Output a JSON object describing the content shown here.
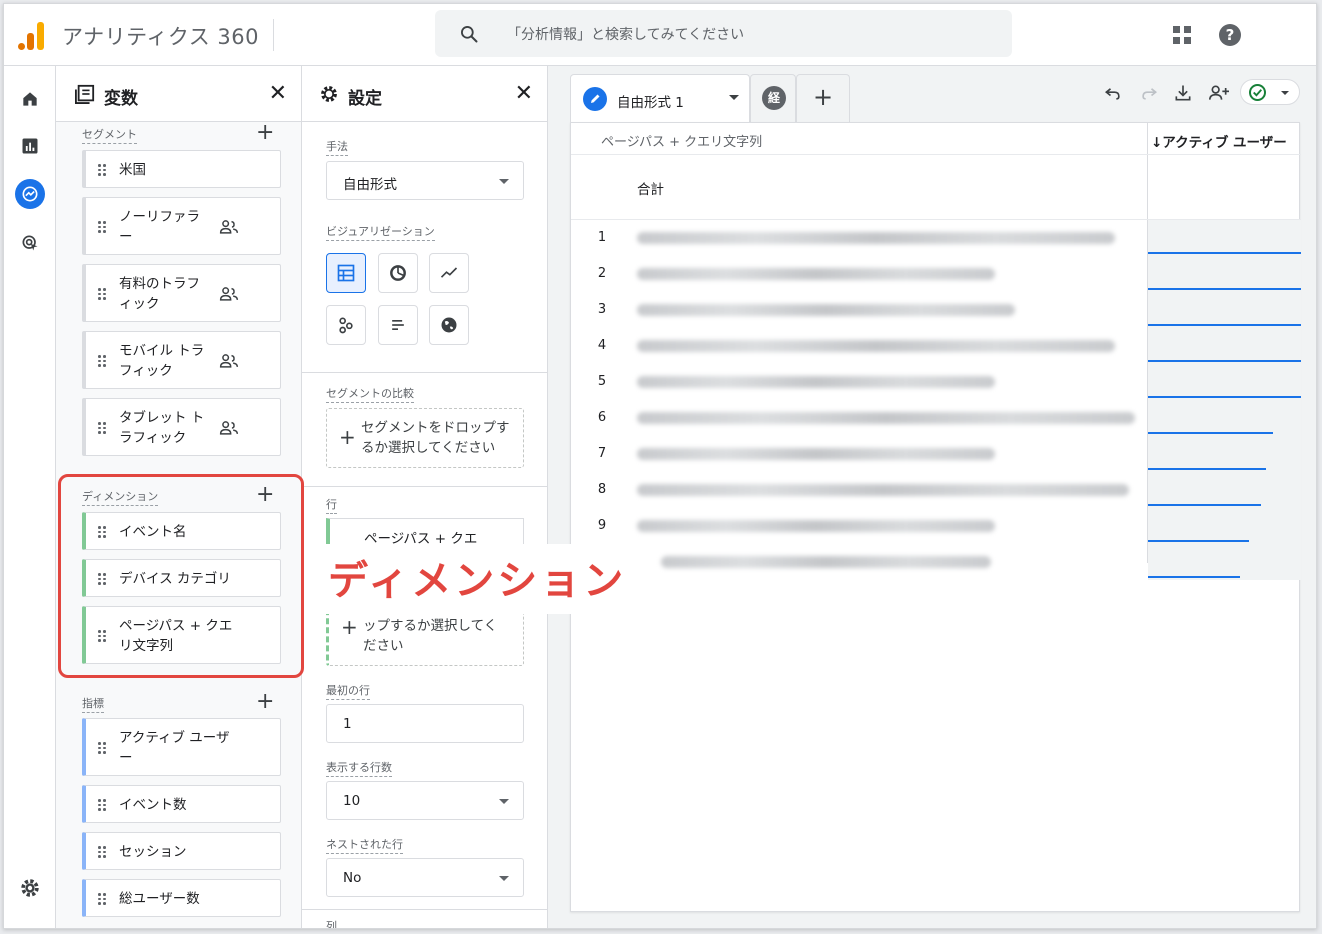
{
  "app": {
    "title": "アナリティクス 360"
  },
  "search": {
    "placeholder": "「分析情報」と検索してみてください"
  },
  "rail": {
    "items": [
      "home-icon",
      "reports-icon",
      "explore-icon",
      "advertising-icon",
      "settings-icon"
    ],
    "active_color": "#1a73e8"
  },
  "variables": {
    "title": "変数",
    "segments_label": "セグメント",
    "segments": [
      {
        "label": "米国",
        "multi": false
      },
      {
        "label": "ノーリファラ\nー",
        "multi": true
      },
      {
        "label": "有料のトラフ\nィック",
        "multi": true
      },
      {
        "label": "モバイル トラ\nフィック",
        "multi": true
      },
      {
        "label": "タブレット ト\nラフィック",
        "multi": true
      }
    ],
    "dimensions_label": "ディメンション",
    "dimensions": [
      {
        "label": "イベント名"
      },
      {
        "label": "デバイス カテゴリ"
      },
      {
        "label": "ページパス + クエ\nリ文字列"
      }
    ],
    "metrics_label": "指標",
    "metrics": [
      {
        "label": "アクティブ ユーザ\nー"
      },
      {
        "label": "イベント数"
      },
      {
        "label": "セッション"
      },
      {
        "label": "総ユーザー数"
      }
    ]
  },
  "annotation": {
    "text": "ディメンション",
    "color": "#e2463f"
  },
  "settings": {
    "title": "設定",
    "technique_label": "手法",
    "technique_value": "自由形式",
    "viz_label": "ビジュアリゼーション",
    "segment_compare_label": "セグメントの比較",
    "segment_drop_text": "セグメントをドロップす\nるか選択してください",
    "rows_label": "行",
    "row_chip": "ページパス + クエ",
    "row_drop_text": "ップするか選択してく\nださい",
    "first_row_label": "最初の行",
    "first_row_value": "1",
    "show_rows_label": "表示する行数",
    "show_rows_value": "10",
    "nested_rows_label": "ネストされた行",
    "nested_rows_value": "No",
    "columns_label": "列"
  },
  "canvas": {
    "tab_name": "自由形式 1",
    "tab2_badge": "経",
    "add_tab": "+",
    "table": {
      "dim_header": "ページパス + クエリ文字列",
      "metric_header": "↓アクティブ ユーザー",
      "total_label": "合計",
      "rows": [
        {
          "n": "1",
          "value": 1.0
        },
        {
          "n": "2",
          "value": 1.0
        },
        {
          "n": "3",
          "value": 1.0
        },
        {
          "n": "4",
          "value": 1.0
        },
        {
          "n": "5",
          "value": 1.0
        },
        {
          "n": "6",
          "value": 0.82
        },
        {
          "n": "7",
          "value": 0.77
        },
        {
          "n": "8",
          "value": 0.74
        },
        {
          "n": "9",
          "value": 0.66
        },
        {
          "n": "",
          "value": 0.6
        }
      ]
    }
  }
}
